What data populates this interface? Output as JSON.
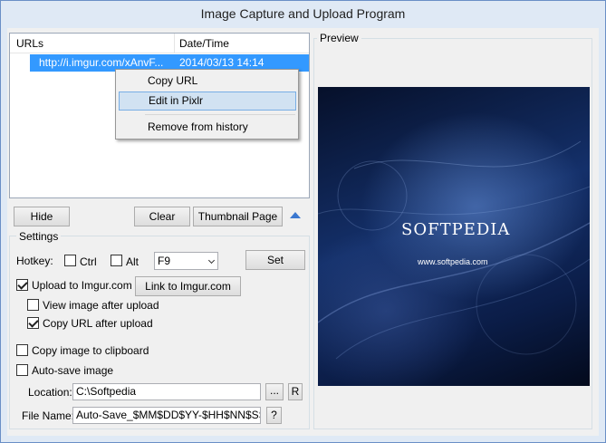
{
  "window": {
    "title": "Image Capture and Upload Program"
  },
  "history": {
    "columns": [
      "URLs",
      "Date/Time"
    ],
    "rows": [
      {
        "url": "http://i.imgur.com/xAnvF...",
        "datetime": "2014/03/13 14:14"
      }
    ]
  },
  "context_menu": {
    "items": [
      "Copy URL",
      "Edit in Pixlr",
      "Remove from history"
    ],
    "highlighted": "Edit in Pixlr"
  },
  "buttons": {
    "hide": "Hide",
    "clear": "Clear",
    "thumbnail_page": "Thumbnail Page",
    "set": "Set",
    "link_to_imgur": "Link to Imgur.com",
    "browse": "...",
    "reset": "R",
    "help": "?"
  },
  "settings": {
    "title": "Settings",
    "hotkey_label": "Hotkey:",
    "ctrl": {
      "label": "Ctrl",
      "checked": false
    },
    "alt": {
      "label": "Alt",
      "checked": false
    },
    "hotkey_key": "F9",
    "upload_to_imgur": {
      "label": "Upload to Imgur.com",
      "checked": true
    },
    "view_after_upload": {
      "label": "View image after upload",
      "checked": false
    },
    "copy_url_after_upload": {
      "label": "Copy URL after upload",
      "checked": true
    },
    "copy_to_clipboard": {
      "label": "Copy image to clipboard",
      "checked": false
    },
    "auto_save": {
      "label": "Auto-save image",
      "checked": false
    },
    "location_label": "Location:",
    "location_value": "C:\\Softpedia",
    "filename_label": "File Name:",
    "filename_value": "Auto-Save_$MM$DD$YY-$HH$NN$SS"
  },
  "preview": {
    "title": "Preview",
    "brand": "SOFTPEDIA",
    "brand_url": "www.softpedia.com"
  }
}
